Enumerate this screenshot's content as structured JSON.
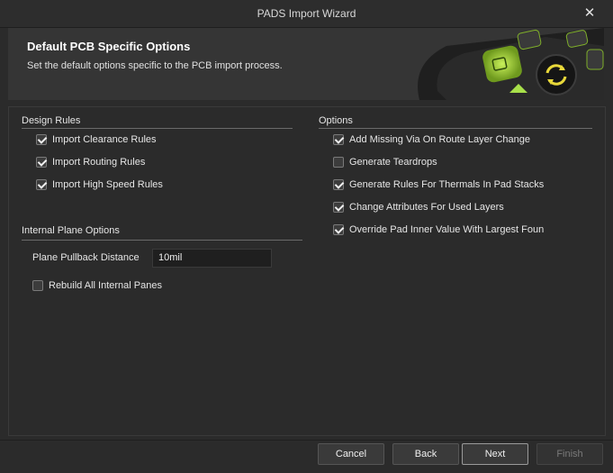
{
  "window": {
    "title": "PADS Import Wizard",
    "close_label": "✕"
  },
  "header": {
    "title": "Default PCB Specific Options",
    "subtitle": "Set the default options specific to the PCB import process."
  },
  "design_rules": {
    "title": "Design Rules",
    "items": [
      {
        "label": "Import Clearance Rules",
        "checked": true
      },
      {
        "label": "Import Routing Rules",
        "checked": true
      },
      {
        "label": "Import High Speed Rules",
        "checked": true
      }
    ]
  },
  "internal_plane": {
    "title": "Internal Plane Options",
    "pullback_label": "Plane Pullback Distance",
    "pullback_value": "10mil",
    "rebuild_label": "Rebuild All Internal Panes",
    "rebuild_checked": false
  },
  "options": {
    "title": "Options",
    "items": [
      {
        "label": "Add Missing Via On Route Layer Change",
        "checked": true
      },
      {
        "label": "Generate Teardrops",
        "checked": false
      },
      {
        "label": "Generate Rules For Thermals In Pad Stacks",
        "checked": true
      },
      {
        "label": "Change Attributes For Used Layers",
        "checked": true
      },
      {
        "label": "Override Pad Inner Value With Largest Foun",
        "checked": true
      }
    ]
  },
  "buttons": {
    "cancel": "Cancel",
    "back": "Back",
    "next": "Next",
    "finish": "Finish"
  },
  "colors": {
    "accent_green": "#a8e04a",
    "background": "#2b2b2b"
  }
}
